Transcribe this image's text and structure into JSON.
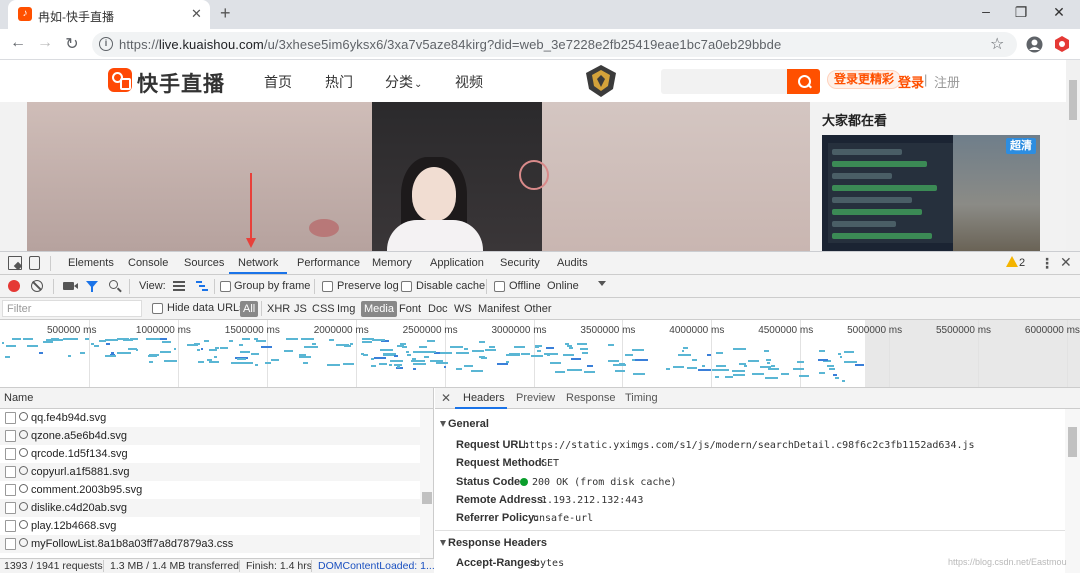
{
  "browser": {
    "tab_title": "冉如-快手直播",
    "tab_close": "✕",
    "new_tab": "+",
    "url_prefix": "https://",
    "url_host": "live.kuaishou.com",
    "url_rest": "/u/3xhese5im6yksx6/3xa7v5aze84kirg?did=web_3e7228e2fb25419eae1bc7a0eb29bbde",
    "back": "←",
    "forward": "→",
    "reload": "↻"
  },
  "site": {
    "logo_text": "快手直播",
    "nav": [
      "首页",
      "热门",
      "分类",
      "视频"
    ],
    "nav_arrow": "⌄",
    "promo": "登录更精彩",
    "login": "登录",
    "separator": "|",
    "register": "注册",
    "side_title": "大家都在看",
    "thumb_badge": "超清"
  },
  "devtools": {
    "tabs": [
      "Elements",
      "Console",
      "Sources",
      "Network",
      "Performance",
      "Memory",
      "Application",
      "Security",
      "Audits"
    ],
    "active_tab": "Network",
    "warning_count": "2",
    "menu": "⋮",
    "close": "✕",
    "toolbar": {
      "view_label": "View:",
      "group_by_frame": "Group by frame",
      "preserve_log": "Preserve log",
      "disable_cache": "Disable cache",
      "offline": "Offline",
      "throttling": "Online"
    },
    "filter": {
      "placeholder": "Filter",
      "hide_data_urls": "Hide data URLs",
      "types": [
        "All",
        "XHR",
        "JS",
        "CSS",
        "Img",
        "Media",
        "Font",
        "Doc",
        "WS",
        "Manifest",
        "Other"
      ],
      "selected": [
        "All",
        "Media"
      ]
    },
    "overview_ticks": [
      "500000 ms",
      "1000000 ms",
      "1500000 ms",
      "2000000 ms",
      "2500000 ms",
      "3000000 ms",
      "3500000 ms",
      "4000000 ms",
      "4500000 ms",
      "5000000 ms",
      "5500000 ms",
      "6000000 ms"
    ],
    "list_header": "Name",
    "requests": [
      "qq.fe4b94d.svg",
      "qzone.a5e6b4d.svg",
      "qrcode.1d5f134.svg",
      "copyurl.a1f5881.svg",
      "comment.2003b95.svg",
      "dislike.c4d20ab.svg",
      "play.12b4668.svg",
      "myFollowList.8a1b8a03ff7a8d7879a3.css"
    ],
    "status": {
      "requests": "1393 / 1941 requests",
      "transferred": "1.3 MB / 1.4 MB transferred",
      "finish": "Finish: 1.4 hrs",
      "dom_loaded": "DOMContentLoaded: 1..."
    },
    "detail_tabs": [
      "Headers",
      "Preview",
      "Response",
      "Timing"
    ],
    "detail_close": "✕",
    "general": {
      "title": "General",
      "rows": [
        {
          "key": "Request URL:",
          "value": "https://static.yximgs.com/s1/js/modern/searchDetail.c98f6c2c3fb1152ad634.js"
        },
        {
          "key": "Request Method:",
          "value": "GET"
        },
        {
          "key": "Status Code:",
          "value": "200 OK (from disk cache)"
        },
        {
          "key": "Remote Address:",
          "value": "1.193.212.132:443"
        },
        {
          "key": "Referrer Policy:",
          "value": "unsafe-url"
        }
      ]
    },
    "response_headers": {
      "title": "Response Headers",
      "rows": [
        {
          "key": "Accept-Ranges:",
          "value": "bytes"
        }
      ]
    }
  },
  "watermark": "https://blog.csdn.net/Eastmou"
}
